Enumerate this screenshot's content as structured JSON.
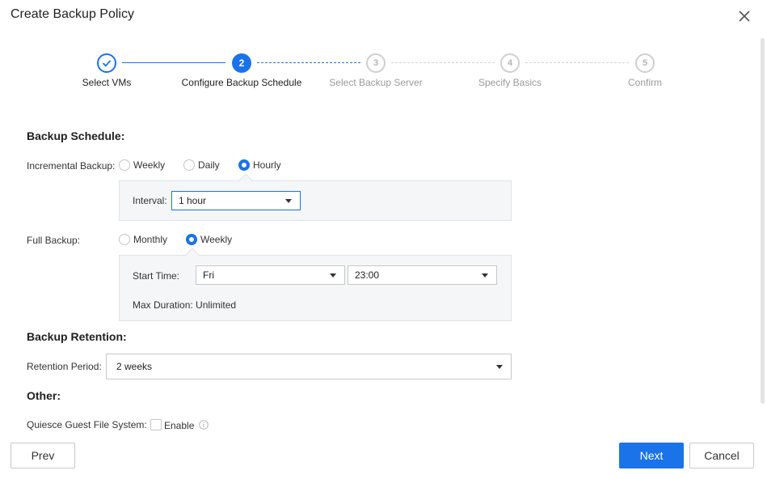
{
  "dialog": {
    "title": "Create Backup Policy"
  },
  "steps": [
    {
      "number": "1",
      "label": "Select VMs",
      "state": "done"
    },
    {
      "number": "2",
      "label": "Configure Backup Schedule",
      "state": "active"
    },
    {
      "number": "3",
      "label": "Select Backup Server",
      "state": "todo"
    },
    {
      "number": "4",
      "label": "Specify Basics",
      "state": "todo"
    },
    {
      "number": "5",
      "label": "Confirm",
      "state": "todo"
    }
  ],
  "schedule": {
    "section_title": "Backup Schedule:",
    "incremental": {
      "label": "Incremental Backup:",
      "options": [
        "Weekly",
        "Daily",
        "Hourly"
      ],
      "selected": "Hourly",
      "interval_label": "Interval:",
      "interval_value": "1 hour"
    },
    "full": {
      "label": "Full Backup:",
      "options": [
        "Monthly",
        "Weekly"
      ],
      "selected": "Weekly",
      "start_time_label": "Start Time:",
      "day_value": "Fri",
      "time_value": "23:00",
      "max_duration": "Max Duration: Unlimited"
    }
  },
  "retention": {
    "section_title": "Backup Retention:",
    "period_label": "Retention Period:",
    "period_value": "2 weeks"
  },
  "other": {
    "section_title": "Other:",
    "quiesce_label": "Quiesce Guest File System:",
    "enable_label": "Enable",
    "enabled": false
  },
  "footer": {
    "prev_label": "Prev",
    "next_label": "Next",
    "cancel_label": "Cancel"
  },
  "colors": {
    "accent": "#1a73e8",
    "panel_bg": "#f5f6f8",
    "muted_text": "#9a9a9a"
  },
  "icons": {
    "close": "close-icon",
    "check": "check-icon",
    "info": "info-icon",
    "dropdown": "chevron-down-icon"
  }
}
